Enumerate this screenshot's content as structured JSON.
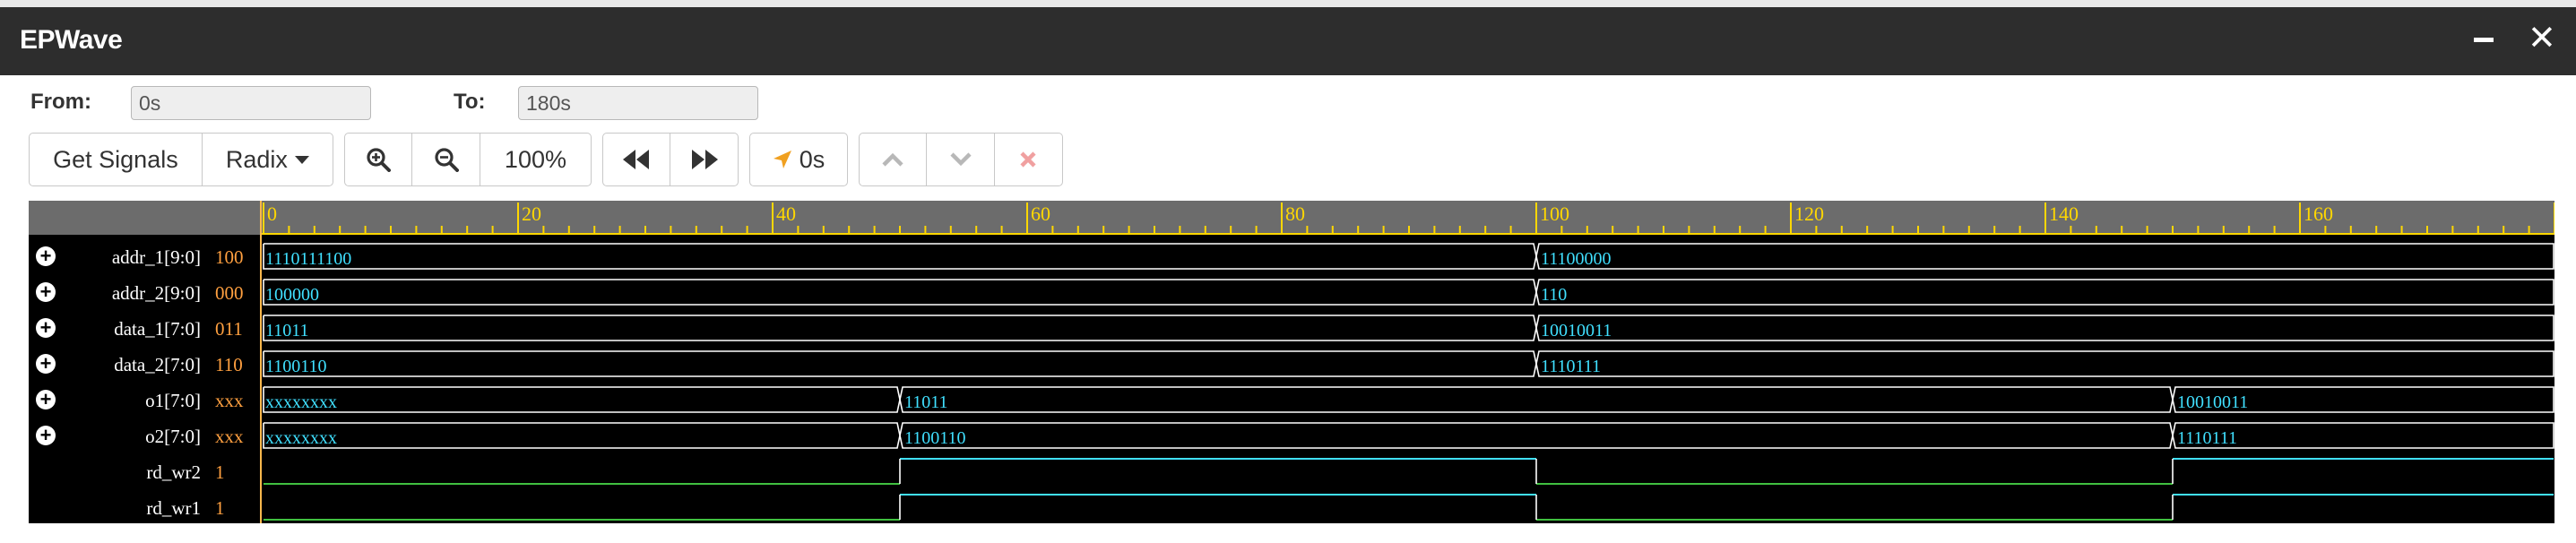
{
  "window": {
    "title": "EPWave",
    "minimize_label": "_",
    "close_label": "✕"
  },
  "range": {
    "from_label": "From:",
    "from_value": "0s",
    "to_label": "To:",
    "to_value": "180s"
  },
  "toolbar": {
    "get_signals": "Get Signals",
    "radix": "Radix",
    "zoom_level": "100%",
    "cursor_time": "0s",
    "icons": [
      "zoom-in-icon",
      "zoom-out-icon",
      "rewind-icon",
      "fast-forward-icon",
      "cursor-arrow-icon",
      "chevron-up-icon",
      "chevron-down-icon",
      "delete-icon"
    ]
  },
  "colors": {
    "titlebar_bg": "#2d2d2d",
    "wave_bg": "#000000",
    "ruler_bg": "#6c6c6c",
    "ruler_tick": "#ffd700",
    "bus_text": "#40e0ff",
    "bus_line": "#ffffff",
    "bit_high": "#40e0ff",
    "bit_low": "#40c040",
    "value_text": "#ffa040"
  },
  "timeline": {
    "start": 0,
    "end": 180,
    "labels": [
      0,
      20,
      40,
      60,
      80,
      100,
      120,
      140,
      160
    ]
  },
  "signals": [
    {
      "name": "addr_1[9:0]",
      "value": "100",
      "type": "bus",
      "expandable": true,
      "segments": [
        {
          "t": 0,
          "v": "1110111100"
        },
        {
          "t": 100,
          "v": "11100000"
        }
      ]
    },
    {
      "name": "addr_2[9:0]",
      "value": "000",
      "type": "bus",
      "expandable": true,
      "segments": [
        {
          "t": 0,
          "v": "100000"
        },
        {
          "t": 100,
          "v": "110"
        }
      ]
    },
    {
      "name": "data_1[7:0]",
      "value": "011",
      "type": "bus",
      "expandable": true,
      "segments": [
        {
          "t": 0,
          "v": "11011"
        },
        {
          "t": 100,
          "v": "10010011"
        }
      ]
    },
    {
      "name": "data_2[7:0]",
      "value": "110",
      "type": "bus",
      "expandable": true,
      "segments": [
        {
          "t": 0,
          "v": "1100110"
        },
        {
          "t": 100,
          "v": "1110111"
        }
      ]
    },
    {
      "name": "o1[7:0]",
      "value": "xxx",
      "type": "bus",
      "expandable": true,
      "segments": [
        {
          "t": 0,
          "v": "xxxxxxxx"
        },
        {
          "t": 50,
          "v": "11011"
        },
        {
          "t": 150,
          "v": "10010011"
        }
      ]
    },
    {
      "name": "o2[7:0]",
      "value": "xxx",
      "type": "bus",
      "expandable": true,
      "segments": [
        {
          "t": 0,
          "v": "xxxxxxxx"
        },
        {
          "t": 50,
          "v": "1100110"
        },
        {
          "t": 150,
          "v": "1110111"
        }
      ]
    },
    {
      "name": "rd_wr2",
      "value": "1",
      "type": "bit",
      "expandable": false,
      "steps": [
        {
          "t": 0,
          "v": 0
        },
        {
          "t": 50,
          "v": 1
        },
        {
          "t": 100,
          "v": 0
        },
        {
          "t": 150,
          "v": 1
        }
      ]
    },
    {
      "name": "rd_wr1",
      "value": "1",
      "type": "bit",
      "expandable": false,
      "steps": [
        {
          "t": 0,
          "v": 0
        },
        {
          "t": 50,
          "v": 1
        },
        {
          "t": 100,
          "v": 0
        },
        {
          "t": 150,
          "v": 1
        }
      ]
    }
  ]
}
